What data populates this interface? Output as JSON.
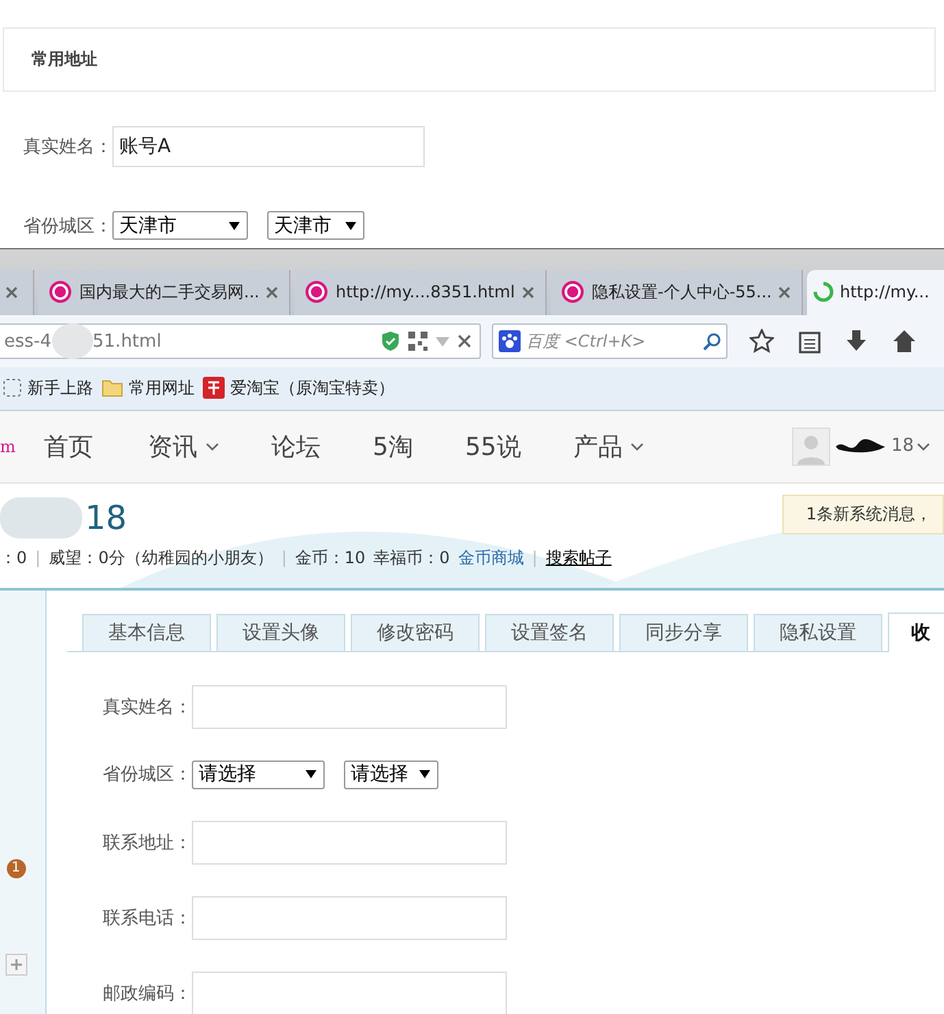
{
  "address_panel": {
    "title": "常用地址",
    "fields": [
      {
        "kind": "text",
        "label": "真实姓名：",
        "value": "账号A"
      },
      {
        "kind": "selects",
        "label": "省份城区：",
        "selects": [
          "天津市",
          "天津市"
        ]
      }
    ]
  },
  "browser": {
    "tabs": [
      {
        "selected": false
      },
      {
        "title": "国内最大的二手交易网...",
        "selected": false
      },
      {
        "title": "http://my....8351.html",
        "selected": false
      },
      {
        "title": "隐私设置-个人中心-55...",
        "selected": false
      },
      {
        "title": "http://my...",
        "selected": true
      }
    ],
    "url_start": "ess-4",
    "url_end": "51.html",
    "search_placeholder": "百度 <Ctrl+K>",
    "bookmarks": [
      {
        "label": "新手上路"
      },
      {
        "label": "常用网址"
      },
      {
        "label": "爱淘宝（原淘宝特卖）"
      }
    ]
  },
  "site": {
    "logo_fragment": "m",
    "nav": [
      {
        "label": "首页",
        "dropdown": false
      },
      {
        "label": "资讯",
        "dropdown": true
      },
      {
        "label": "论坛",
        "dropdown": false
      },
      {
        "label": "5淘",
        "dropdown": false
      },
      {
        "label": "55说",
        "dropdown": false
      },
      {
        "label": "产品",
        "dropdown": true
      }
    ],
    "user_suffix": "18",
    "profile": {
      "name_suffix": "18",
      "notice": "1条新系统消息，",
      "stats": [
        {
          "kind": "text",
          "text": "：0"
        },
        {
          "kind": "sep",
          "text": "|"
        },
        {
          "kind": "text",
          "text": "威望：0分（幼稚园的小朋友）"
        },
        {
          "kind": "sep",
          "text": "|"
        },
        {
          "kind": "text",
          "text": "金币：10"
        },
        {
          "kind": "text",
          "text": "幸福币：0"
        },
        {
          "kind": "link",
          "text": "金币商城"
        },
        {
          "kind": "sep",
          "text": "|"
        },
        {
          "kind": "underline",
          "text": "搜索帖子"
        }
      ]
    },
    "sidebar": {
      "badge": "1"
    },
    "tabs": [
      {
        "label": "基本信息",
        "selected": false
      },
      {
        "label": "设置头像",
        "selected": false
      },
      {
        "label": "修改密码",
        "selected": false
      },
      {
        "label": "设置签名",
        "selected": false
      },
      {
        "label": "同步分享",
        "selected": false
      },
      {
        "label": "隐私设置",
        "selected": false
      },
      {
        "label": "收",
        "selected": true
      }
    ],
    "form": [
      {
        "kind": "text",
        "label": "真实姓名："
      },
      {
        "kind": "selects",
        "label": "省份城区：",
        "selects": [
          "请选择",
          "请选择"
        ]
      },
      {
        "kind": "text",
        "label": "联系地址："
      },
      {
        "kind": "text",
        "label": "联系电话："
      },
      {
        "kind": "text",
        "label": "邮政编码："
      }
    ]
  }
}
